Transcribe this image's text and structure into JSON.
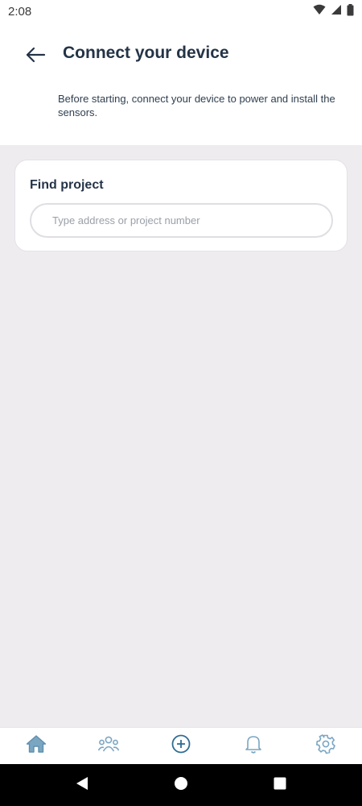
{
  "status_bar": {
    "time": "2:08",
    "icons": [
      "wifi-icon",
      "signal-icon",
      "battery-icon"
    ]
  },
  "header": {
    "back_icon": "arrow-left-icon",
    "title": "Connect your device",
    "subtitle": "Before starting, connect your device to power and install the sensors."
  },
  "find_project": {
    "title": "Find project",
    "search_placeholder": "Type address or project number",
    "search_value": ""
  },
  "bottom_nav": {
    "items": [
      {
        "icon": "home-icon",
        "active": true
      },
      {
        "icon": "people-icon",
        "active": false
      },
      {
        "icon": "add-circle-icon",
        "active": false
      },
      {
        "icon": "bell-icon",
        "active": false
      },
      {
        "icon": "gear-icon",
        "active": false
      }
    ]
  },
  "system_nav": {
    "icons": [
      "back-triangle-icon",
      "home-circle-icon",
      "recents-square-icon"
    ]
  },
  "colors": {
    "accent": "#3f7fa8",
    "title": "#243447",
    "content_bg": "#eeecef",
    "nav_icon": "#7aa6c2"
  }
}
